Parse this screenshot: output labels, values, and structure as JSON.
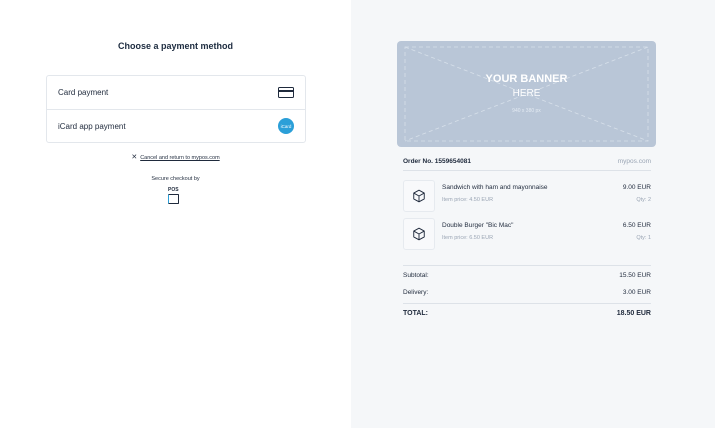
{
  "payment": {
    "title": "Choose a payment method",
    "methods": [
      {
        "label": "Card payment",
        "icon": "credit-card-icon"
      },
      {
        "label": "iCard app payment",
        "icon": "icard-logo-icon",
        "badge": "iCard"
      }
    ],
    "cancel_icon": "close-icon",
    "cancel_link": "Cancel and return to mypos.com",
    "secure_text": "Secure checkout by",
    "logo_text": "POS"
  },
  "banner": {
    "line1": "YOUR BANNER",
    "line2": "HERE",
    "size": "940 x 380 px"
  },
  "order": {
    "number": "Order No. 1559654081",
    "site": "mypos.com",
    "items": [
      {
        "name": "Sandwich with ham and mayonnaise",
        "unit_price": "Item price: 4.50 EUR",
        "total": "9.00 EUR",
        "qty": "Qty: 2",
        "icon": "package-icon"
      },
      {
        "name": "Double Burger \"Bic Mac\"",
        "unit_price": "Item price: 6.50 EUR",
        "total": "6.50 EUR",
        "qty": "Qty: 1",
        "icon": "package-icon"
      }
    ],
    "subtotal_label": "Subtotal:",
    "subtotal_value": "15.50 EUR",
    "delivery_label": "Delivery:",
    "delivery_value": "3.00 EUR",
    "total_label": "TOTAL:",
    "total_value": "18.50 EUR"
  },
  "colors": {
    "accent": "#2b9fd8",
    "banner_bg": "#b9c6d7",
    "right_panel_bg": "#f5f7f9",
    "text": "#1f2a3c",
    "muted": "#9aa5b4"
  }
}
